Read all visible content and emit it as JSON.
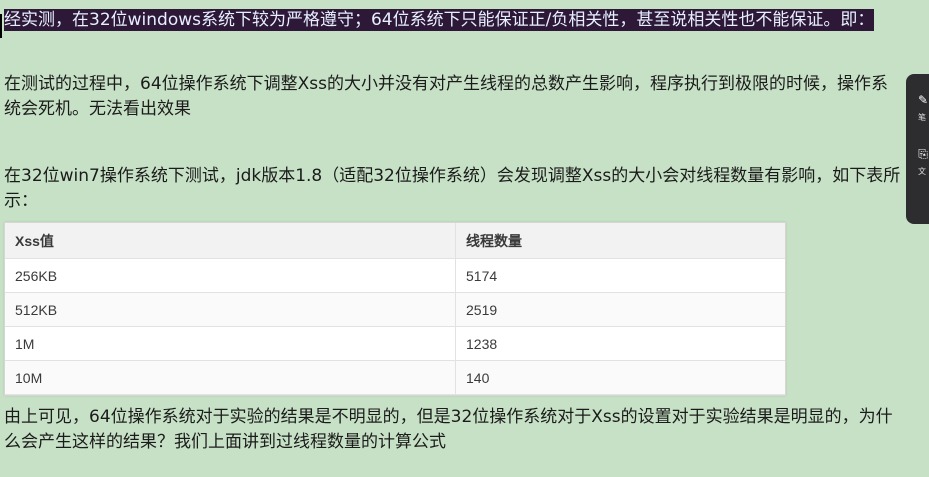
{
  "paragraphs": {
    "p1": "经实测，在32位windows系统下较为严格遵守；64位系统下只能保证正/负相关性，甚至说相关性也不能保证。即：",
    "p2": "在测试的过程中，64位操作系统下调整Xss的大小并没有对产生线程的总数产生影响，程序执行到极限的时候，操作系统会死机。无法看出效果",
    "p3": "在32位win7操作系统下测试，jdk版本1.8（适配32位操作系统）会发现调整Xss的大小会对线程数量有影响，如下表所示：",
    "p4": "由上可见，64位操作系统对于实验的结果是不明显的，但是32位操作系统对于Xss的设置对于实验结果是明显的，为什么会产生这样的结果？我们上面讲到过线程数量的计算公式"
  },
  "table": {
    "headers": [
      "Xss值",
      "线程数量"
    ],
    "rows": [
      [
        "256KB",
        "5174"
      ],
      [
        "512KB",
        "2519"
      ],
      [
        "1M",
        "1238"
      ],
      [
        "10M",
        "140"
      ]
    ]
  },
  "side_panel": {
    "item1_glyph": "笔",
    "item2_glyph": "文"
  },
  "colors": {
    "background": "#c7e1c6",
    "highlight": "#2d1838",
    "side_panel": "#2d2d30"
  }
}
